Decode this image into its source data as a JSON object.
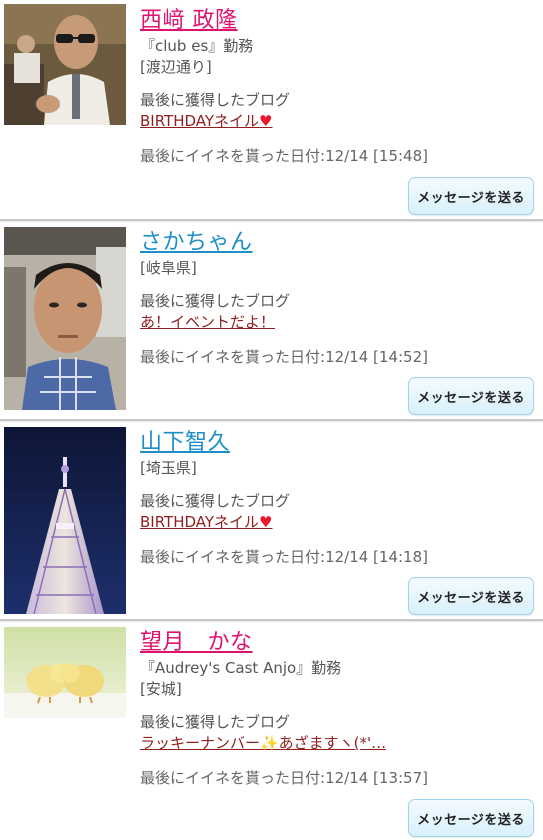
{
  "list": {
    "last_blog_label": "最後に獲得したブログ",
    "last_like_label": "最後にイイネを貰った日付:",
    "message_button_label": "メッセージを送る",
    "entries": [
      {
        "name": "西﨑 政隆",
        "name_color": "#e0126f",
        "workplace": "『club es』勤務",
        "location": "[渡辺通り]",
        "blog_title": "BIRTHDAYネイル",
        "blog_suffix_icon": "heart-icon",
        "like_date": "12/14 [15:48]",
        "photo": "man-with-glasses-photo"
      },
      {
        "name": "さかちゃん",
        "name_color": "#1e8ec9",
        "workplace": "",
        "location": "[岐阜県]",
        "blog_title": "あ！イベントだよ！",
        "blog_suffix_icon": "",
        "like_date": "12/14 [14:52]",
        "photo": "man-in-car-photo"
      },
      {
        "name": "山下智久",
        "name_color": "#1e8ec9",
        "workplace": "",
        "location": "[埼玉県]",
        "blog_title": "BIRTHDAYネイル",
        "blog_suffix_icon": "heart-icon",
        "like_date": "12/14 [14:18]",
        "photo": "tower-at-night-photo"
      },
      {
        "name": "望月　かな",
        "name_color": "#e0126f",
        "workplace": "『Audrey's Cast Anjo』勤務",
        "location": "[安城]",
        "blog_title": "ラッキーナンバー✨あざますヽ(*'…",
        "blog_suffix_icon": "sparkle-icon",
        "like_date": "12/14 [13:57]",
        "photo": "chicks-photo"
      }
    ]
  }
}
